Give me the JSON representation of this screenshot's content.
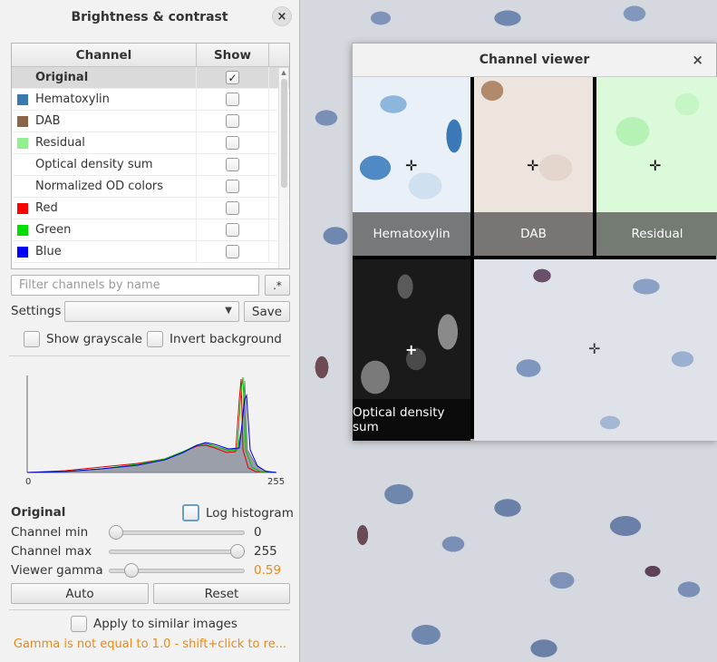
{
  "bc_panel": {
    "title": "Brightness & contrast",
    "close_icon": "×",
    "table": {
      "col_channel": "Channel",
      "col_show": "Show",
      "rows": [
        {
          "name": "Original",
          "color": "",
          "checked": "✓"
        },
        {
          "name": "Hematoxylin",
          "color": "#3b78b0",
          "checked": ""
        },
        {
          "name": "DAB",
          "color": "#8a6647",
          "checked": ""
        },
        {
          "name": "Residual",
          "color": "#90f090",
          "checked": ""
        },
        {
          "name": "Optical density sum",
          "color": "",
          "checked": ""
        },
        {
          "name": "Normalized OD colors",
          "color": "",
          "checked": ""
        },
        {
          "name": "Red",
          "color": "#ff0000",
          "checked": ""
        },
        {
          "name": "Green",
          "color": "#00dd00",
          "checked": ""
        },
        {
          "name": "Blue",
          "color": "#0000ff",
          "checked": ""
        }
      ]
    },
    "filter_placeholder": "Filter channels by name",
    "regex_label": ".*",
    "settings_label": "Settings",
    "save_label": "Save",
    "show_grayscale": "Show grayscale",
    "invert_background": "Invert background",
    "histogram": {
      "x_min_label": "0",
      "x_max_label": "255"
    },
    "original_label": "Original",
    "log_histogram": "Log histogram",
    "channel_min_label": "Channel min",
    "channel_min_value": "0",
    "channel_max_label": "Channel max",
    "channel_max_value": "255",
    "viewer_gamma_label": "Viewer gamma",
    "viewer_gamma_value": "0.59",
    "auto_label": "Auto",
    "reset_label": "Reset",
    "apply_similar": "Apply to similar images",
    "gamma_warning": "Gamma is not equal to 1.0 - shift+click to re..."
  },
  "channel_viewer": {
    "title": "Channel viewer",
    "close_icon": "×",
    "tiles": [
      "Hematoxylin",
      "DAB",
      "Residual",
      "Optical density sum"
    ]
  },
  "sliders": {
    "channel_min": 0,
    "channel_max": 1,
    "gamma": 0.13
  }
}
